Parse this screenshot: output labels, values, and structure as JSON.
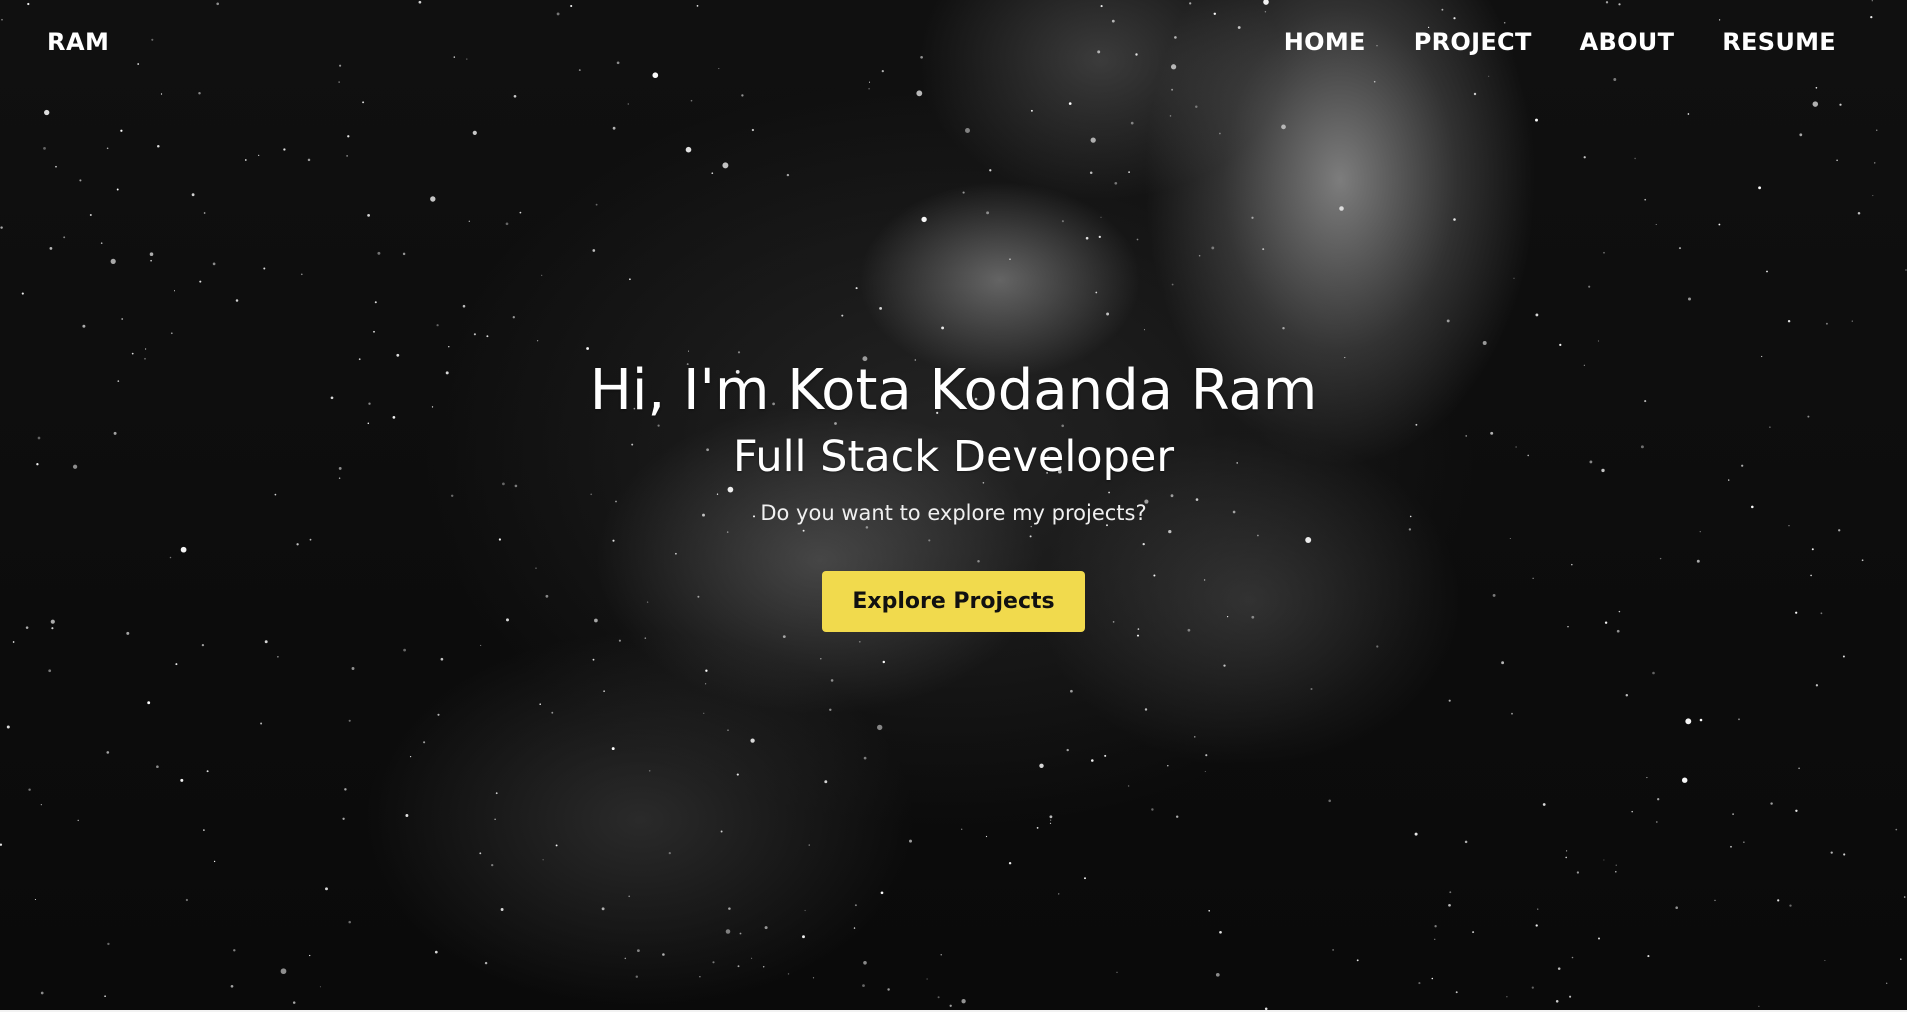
{
  "header": {
    "brand": "RAM",
    "nav": [
      {
        "label": "HOME"
      },
      {
        "label": "PROJECT"
      },
      {
        "label": "ABOUT"
      },
      {
        "label": "RESUME"
      }
    ]
  },
  "hero": {
    "title": "Hi, I'm Kota Kodanda Ram",
    "subtitle": "Full Stack Developer",
    "tagline": "Do you want to explore my projects?",
    "cta_label": "Explore Projects"
  },
  "colors": {
    "accent": "#f1da4d",
    "text": "#ffffff",
    "background": "#0b0b0b"
  }
}
